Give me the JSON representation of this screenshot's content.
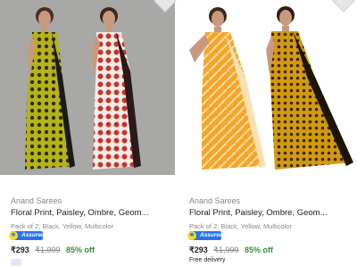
{
  "products": [
    {
      "brand": "Anand Sarees",
      "title": "Floral Print, Paisley, Ombre, Geom...",
      "variant": "Pack of 2, Black, Yellow, Multicolor",
      "assured": "Assured",
      "price": "₹293",
      "mrp": "₹1,999",
      "discount": "85% off",
      "image_icon": "saree-photo",
      "colors": {
        "background": "#a8a8a6",
        "saree_a": "#c9c21c",
        "saree_b": "#d8403a"
      }
    },
    {
      "brand": "Anand Sarees",
      "title": "Floral Print, Paisley, Ombre, Geom...",
      "variant": "Pack of 2, Black, Yellow, Multicolor",
      "assured": "Assured",
      "price": "₹293",
      "mrp": "₹1,999",
      "discount": "85% off",
      "delivery": "Free delivery",
      "image_icon": "saree-photo",
      "colors": {
        "background": "#ffffff",
        "saree_a": "#f5a21f",
        "saree_b": "#c98b0d"
      }
    }
  ],
  "accent": {
    "assured_badge": "#2874f0",
    "discount": "#388e3c"
  }
}
